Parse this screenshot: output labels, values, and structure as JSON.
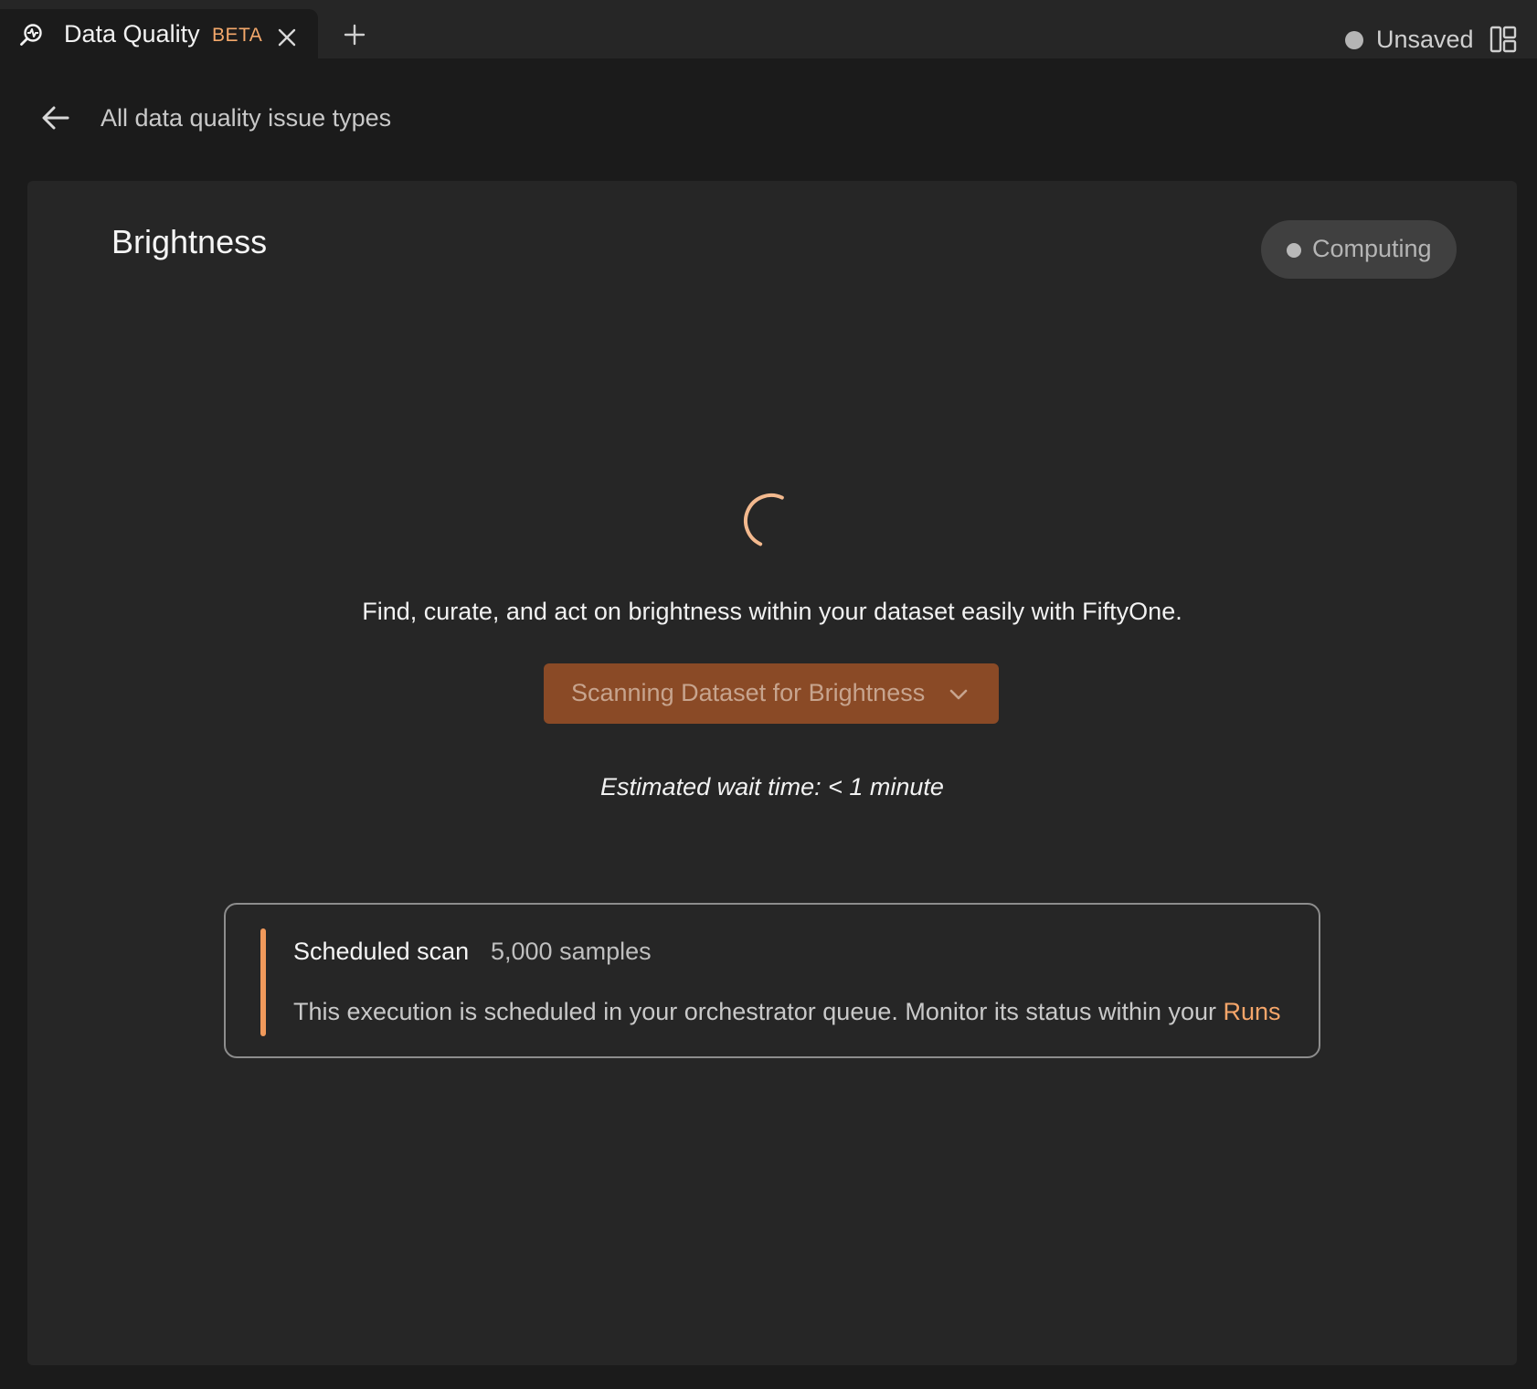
{
  "tab": {
    "icon": "data-quality-icon",
    "title": "Data Quality",
    "badge": "BETA",
    "close_icon": "close-icon",
    "add_icon": "plus-icon"
  },
  "header_right": {
    "status": "Unsaved",
    "layout_icon": "layout-icon"
  },
  "breadcrumb": {
    "back_icon": "arrow-left-icon",
    "label": "All data quality issue types"
  },
  "panel": {
    "title": "Brightness",
    "status": "Computing",
    "description": "Find, curate, and act on brightness within your dataset easily with FiftyOne.",
    "action_button": "Scanning Dataset for Brightness",
    "wait_text": "Estimated wait time: < 1 minute"
  },
  "scan_card": {
    "title": "Scheduled scan",
    "count": "5,000 samples",
    "message": "This execution is scheduled in your orchestrator queue. Monitor its status within your",
    "link": "Runs"
  },
  "colors": {
    "accent": "#f0995b",
    "button": "#8a4a26",
    "background": "#1b1b1b",
    "panel": "#262626"
  }
}
